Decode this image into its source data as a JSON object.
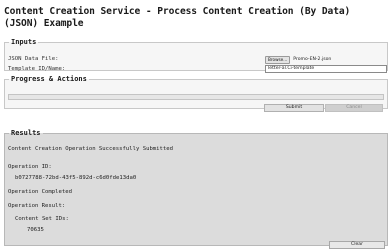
{
  "page": {
    "title": "Content Creation Service - Process Content Creation (By Data) (JSON) Example"
  },
  "inputs": {
    "legend": "Inputs",
    "json_file_label": "JSON Data File:",
    "browse_label": "Browse...",
    "selected_file": "Promo-EN-2.json",
    "template_label": "Template ID/Name:",
    "template_value": "letter-al.Ci-template"
  },
  "progress": {
    "legend": "Progress & Actions",
    "value": 0,
    "submit_label": "Submit",
    "cancel_label": "Cancel"
  },
  "results": {
    "legend": "Results",
    "status_message": "Content Creation Operation Successfully Submitted",
    "operation_id_label": "Operation ID:",
    "operation_id": "b0727788-72bd-43f5-892d-c6d0fde13da0",
    "completion_message": "Operation Completed",
    "operation_result_label": "Operation Result:",
    "content_set_ids_label": "Content Set IDs:",
    "content_set_id": "70635",
    "clear_label": "Clear"
  },
  "colors": {
    "results_background": "#dcdcdc",
    "panel_background": "#f6f6f6",
    "progress_fill": "#8fb3d9"
  }
}
